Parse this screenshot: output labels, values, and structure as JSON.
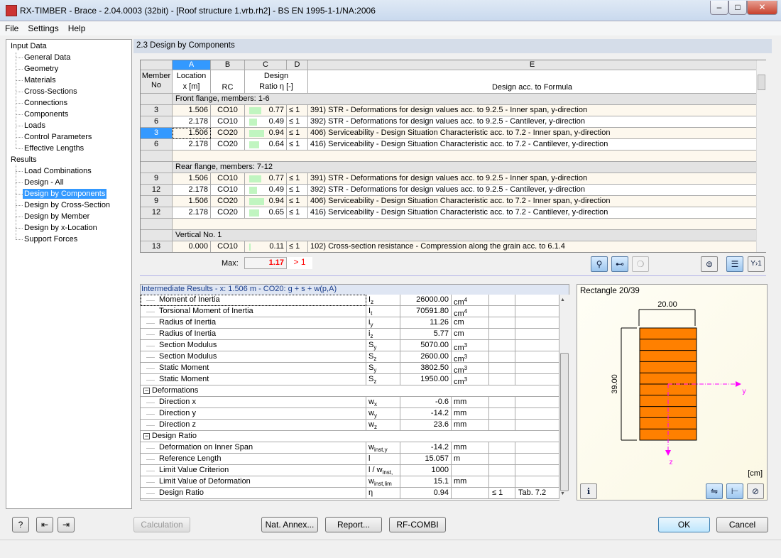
{
  "window": {
    "title": "RX-TIMBER - Brace - 2.04.0003 (32bit) - [Roof structure 1.vrb.rh2] - BS EN 1995-1-1/NA:2006",
    "minimize": "–",
    "maximize": "□",
    "close": "✕"
  },
  "menu": [
    "File",
    "Settings",
    "Help"
  ],
  "nav": {
    "input_header": "Input Data",
    "input_items": [
      "General Data",
      "Geometry",
      "Materials",
      "Cross-Sections",
      "Connections",
      "Components",
      "Loads",
      "Control Parameters",
      "Effective Lengths"
    ],
    "results_header": "Results",
    "results_items": [
      "Load Combinations",
      "Design - All",
      "Design by Components",
      "Design by Cross-Section",
      "Design by Member",
      "Design by x-Location",
      "Support Forces"
    ],
    "selected": "Design by Components"
  },
  "section_title": "2.3 Design by Components",
  "table": {
    "col_letters": [
      "A",
      "B",
      "C",
      "D",
      "E"
    ],
    "headers": {
      "member": "Member No",
      "loc1": "Location",
      "loc2": "x [m]",
      "rc": "RC",
      "design1": "Design",
      "design2": "Ratio η [-]",
      "formula": "Design acc. to Formula"
    },
    "rows": [
      {
        "group": "Front flange, members: 1-6"
      },
      {
        "no": "3",
        "x": "1.506",
        "rc": "CO10",
        "ratio": 0.77,
        "ratio_text": "0.77",
        "cmp": "≤ 1",
        "formula": "391) STR - Deformations for design values acc. to 9.2.5 - Inner span, y-direction"
      },
      {
        "no": "6",
        "x": "2.178",
        "rc": "CO10",
        "ratio": 0.49,
        "ratio_text": "0.49",
        "cmp": "≤ 1",
        "formula": "392) STR - Deformations for design values acc. to 9.2.5 - Cantilever, y-direction"
      },
      {
        "no": "3",
        "x": "1.506",
        "rc": "CO20",
        "ratio": 0.94,
        "ratio_text": "0.94",
        "cmp": "≤ 1",
        "formula": "406) Serviceability - Design Situation Characteristic acc. to 7.2 - Inner span, y-direction",
        "selected": true
      },
      {
        "no": "6",
        "x": "2.178",
        "rc": "CO20",
        "ratio": 0.64,
        "ratio_text": "0.64",
        "cmp": "≤ 1",
        "formula": "416) Serviceability - Design Situation Characteristic acc. to 7.2 - Cantilever, y-direction"
      },
      {
        "empty": true
      },
      {
        "group": "Rear flange, members: 7-12"
      },
      {
        "no": "9",
        "x": "1.506",
        "rc": "CO10",
        "ratio": 0.77,
        "ratio_text": "0.77",
        "cmp": "≤ 1",
        "formula": "391) STR - Deformations for design values acc. to 9.2.5 - Inner span, y-direction"
      },
      {
        "no": "12",
        "x": "2.178",
        "rc": "CO10",
        "ratio": 0.49,
        "ratio_text": "0.49",
        "cmp": "≤ 1",
        "formula": "392) STR - Deformations for design values acc. to 9.2.5 - Cantilever, y-direction"
      },
      {
        "no": "9",
        "x": "1.506",
        "rc": "CO20",
        "ratio": 0.94,
        "ratio_text": "0.94",
        "cmp": "≤ 1",
        "formula": "406) Serviceability - Design Situation Characteristic acc. to 7.2 - Inner span, y-direction"
      },
      {
        "no": "12",
        "x": "2.178",
        "rc": "CO20",
        "ratio": 0.65,
        "ratio_text": "0.65",
        "cmp": "≤ 1",
        "formula": "416) Serviceability - Design Situation Characteristic acc. to 7.2 - Cantilever, y-direction"
      },
      {
        "empty": true
      },
      {
        "group": "Vertical No. 1"
      },
      {
        "no": "13",
        "x": "0.000",
        "rc": "CO10",
        "ratio": 0.11,
        "ratio_text": "0.11",
        "cmp": "≤ 1",
        "formula": "102) Cross-section resistance - Compression along the grain acc. to 6.1.4"
      }
    ],
    "max_label": "Max:",
    "max_value": "1.17",
    "max_cmp": "> 1",
    "max_color": "#ff0000"
  },
  "intermediate": {
    "title": "Intermediate Results  -  x: 1.506 m  -  CO20: g + s + w(p,A)",
    "rows": [
      {
        "name": "Moment of Inertia",
        "sym": "I",
        "sub": "z",
        "val": "26000.00",
        "unit": "cm",
        "sup": "4"
      },
      {
        "name": "Torsional Moment of Inertia",
        "sym": "I",
        "sub": "t",
        "val": "70591.80",
        "unit": "cm",
        "sup": "4"
      },
      {
        "name": "Radius of Inertia",
        "sym": "i",
        "sub": "y",
        "val": "11.26",
        "unit": "cm"
      },
      {
        "name": "Radius of Inertia",
        "sym": "i",
        "sub": "z",
        "val": "5.77",
        "unit": "cm"
      },
      {
        "name": "Section Modulus",
        "sym": "S",
        "sub": "y",
        "val": "5070.00",
        "unit": "cm",
        "sup": "3"
      },
      {
        "name": "Section Modulus",
        "sym": "S",
        "sub": "z",
        "val": "2600.00",
        "unit": "cm",
        "sup": "3"
      },
      {
        "name": "Static Moment",
        "sym": "S",
        "sub": "y",
        "val": "3802.50",
        "unit": "cm",
        "sup": "3"
      },
      {
        "name": "Static Moment",
        "sym": "S",
        "sub": "z",
        "val": "1950.00",
        "unit": "cm",
        "sup": "3"
      },
      {
        "group": "Deformations",
        "toggle": "−"
      },
      {
        "name": "Direction x",
        "sym": "w",
        "sub": "x",
        "val": "-0.6",
        "unit": "mm"
      },
      {
        "name": "Direction y",
        "sym": "w",
        "sub": "y",
        "val": "-14.2",
        "unit": "mm"
      },
      {
        "name": "Direction z",
        "sym": "w",
        "sub": "z",
        "val": "23.6",
        "unit": "mm"
      },
      {
        "group": "Design Ratio",
        "toggle": "−"
      },
      {
        "name": "Deformation on Inner Span",
        "sym": "w",
        "sub": "inst,y",
        "val": "-14.2",
        "unit": "mm"
      },
      {
        "name": "Reference Length",
        "sym": "l",
        "val": "15.057",
        "unit": "m"
      },
      {
        "name": "Limit Value Criterion",
        "sym": "l / w",
        "sub": "inst,",
        "val": "1000"
      },
      {
        "name": "Limit Value of Deformation",
        "sym": "w",
        "sub": "inst,lim",
        "val": "15.1",
        "unit": "mm"
      },
      {
        "name": "Design Ratio",
        "sym": "η",
        "val": "0.94",
        "cmp": "≤ 1",
        "ref": "Tab. 7.2"
      }
    ]
  },
  "section": {
    "title": "Rectangle 20/39",
    "width": "20.00",
    "height": "39.00",
    "axis_y": "y",
    "axis_z": "z",
    "unit": "[cm]",
    "fill": "#ff8000",
    "axis_color": "#ff00ff"
  },
  "buttons": {
    "calculation": "Calculation",
    "nat_annex": "Nat. Annex...",
    "report": "Report...",
    "rfcombi": "RF-COMBI",
    "ok": "OK",
    "cancel": "Cancel"
  }
}
